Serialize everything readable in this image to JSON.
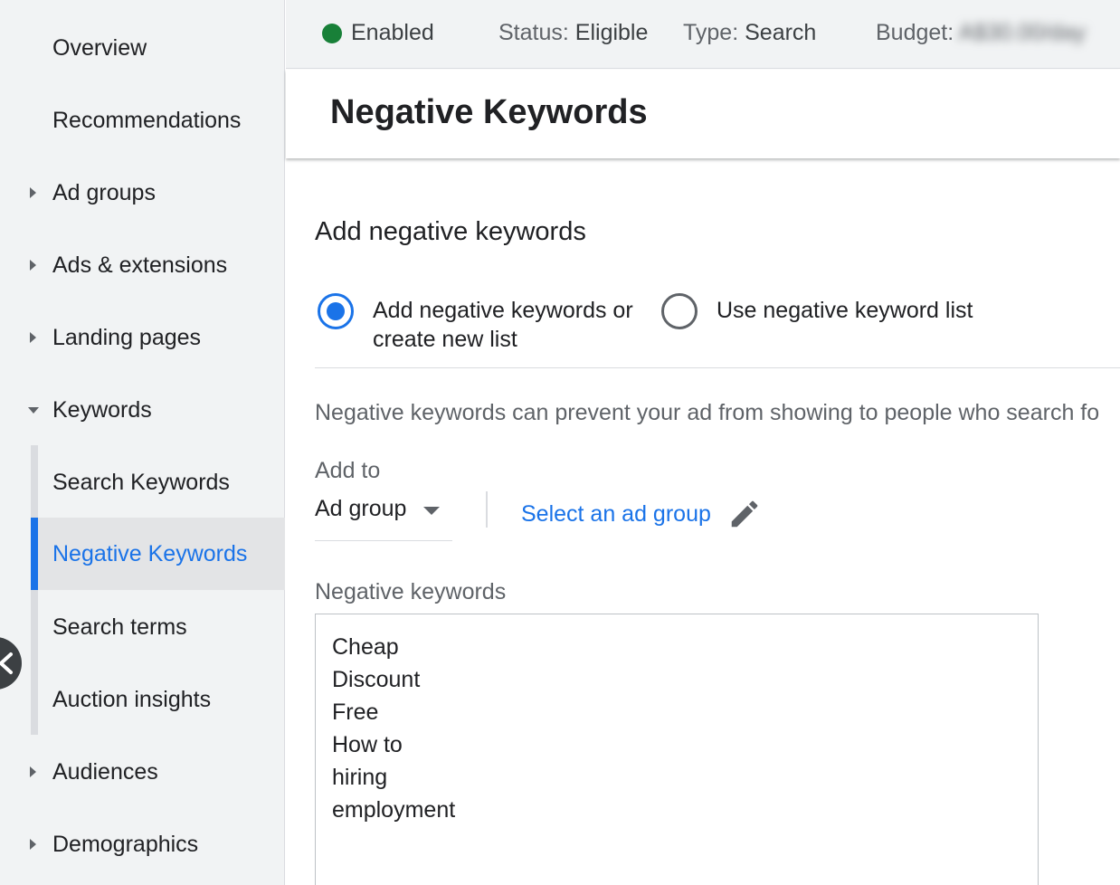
{
  "sidebar": {
    "items": [
      {
        "label": "Overview"
      },
      {
        "label": "Recommendations"
      },
      {
        "label": "Ad groups"
      },
      {
        "label": "Ads & extensions"
      },
      {
        "label": "Landing pages"
      },
      {
        "label": "Keywords"
      },
      {
        "label": "Search Keywords"
      },
      {
        "label": "Negative Keywords"
      },
      {
        "label": "Search terms"
      },
      {
        "label": "Auction insights"
      },
      {
        "label": "Audiences"
      },
      {
        "label": "Demographics"
      }
    ]
  },
  "status_bar": {
    "enabled": "Enabled",
    "status_label": "Status:",
    "status_value": "Eligible",
    "type_label": "Type:",
    "type_value": "Search",
    "budget_label": "Budget:",
    "budget_value": "A$30.00/day",
    "enabled_color": "#188038"
  },
  "header": {
    "title": "Negative Keywords"
  },
  "form": {
    "section_title": "Add negative keywords",
    "radio_options": [
      {
        "label_line1": "Add negative keywords or",
        "label_line2": "create new list",
        "checked": true
      },
      {
        "label_line1": "Use negative keyword list",
        "checked": false
      }
    ],
    "helper_text": "Negative keywords can prevent your ad from showing to people who search fo",
    "add_to_label": "Add to",
    "add_to_value": "Ad group",
    "select_link": "Select an ad group",
    "keywords_label": "Negative keywords",
    "keywords": [
      "Cheap",
      "Discount",
      "Free",
      "How to",
      "hiring",
      "employment"
    ]
  },
  "colors": {
    "accent": "#1a73e8"
  }
}
